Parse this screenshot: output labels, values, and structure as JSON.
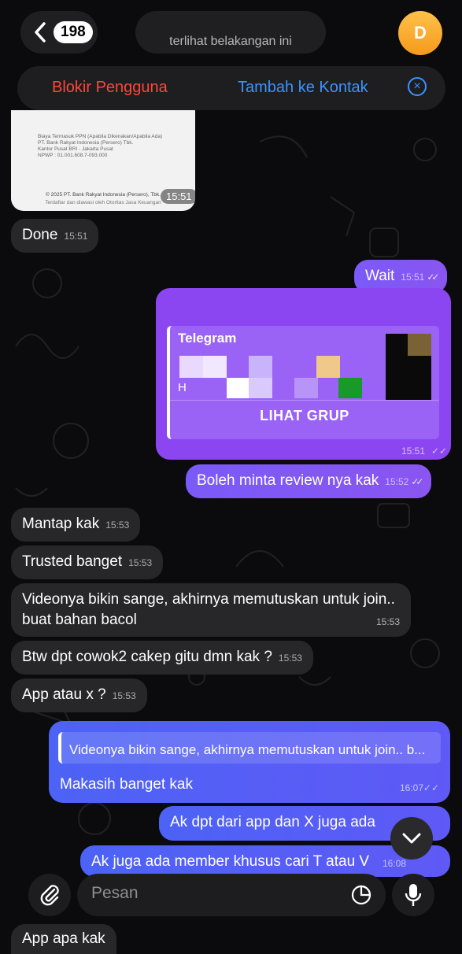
{
  "header": {
    "back_count": "198",
    "title_status": "terlihat belakangan ini",
    "avatar_letter": "D"
  },
  "action_bar": {
    "block_label": "Blokir Pengguna",
    "add_contact_label": "Tambah ke Kontak"
  },
  "image_message": {
    "text_lines": "Biaya Termasuk PPN (Apabila Dikenakan/Apabila Ada)\nPT. Bank Rakyat Indonesia (Persero) Tbk.\nKantor Pusat BRI - Jakarta Pusat\nNPWP : 01.001.608.7-093.000",
    "footer": "© 2025 PT. Bank Rakyat Indonesia (Persero), Tbk.",
    "footer2": "Terdaftar dan diawasi oleh Otoritas Jasa Keuangan",
    "time": "15:51"
  },
  "messages": [
    {
      "text": "Done",
      "time": "15:51"
    },
    {
      "text": "Wait",
      "time": "15:51"
    },
    {
      "text": "Boleh minta review nya kak",
      "time": "15:52"
    },
    {
      "text": "Mantap kak",
      "time": "15:53"
    },
    {
      "text": "Trusted banget",
      "time": "15:53"
    },
    {
      "text": "Videonya bikin sange, akhirnya memutuskan untuk join.. buat bahan bacol",
      "time": "15:53"
    },
    {
      "text": "Btw dpt cowok2 cakep gitu dmn kak ?",
      "time": "15:53"
    },
    {
      "text": "App atau x ?",
      "time": "15:53"
    },
    {
      "text": "Makasih banget kak",
      "time": "16:07"
    },
    {
      "text": "Ak dpt dari app dan X juga ada",
      "time": ""
    },
    {
      "text": "Ak juga ada member khusus cari T atau V",
      "time": "16:08"
    },
    {
      "text": "App apa kak",
      "time": ""
    }
  ],
  "link_card": {
    "site": "Telegram",
    "button": "LIHAT GRUP",
    "time": "15:51",
    "sub_initial": "H"
  },
  "reply_quote": "Videonya bikin sange, akhirnya memutuskan untuk join.. b...",
  "composer": {
    "placeholder": "Pesan"
  },
  "colors": {
    "outgoing": "#8a55f0",
    "incoming": "#27272a",
    "block": "#ff453a",
    "link": "#3a93ff"
  }
}
